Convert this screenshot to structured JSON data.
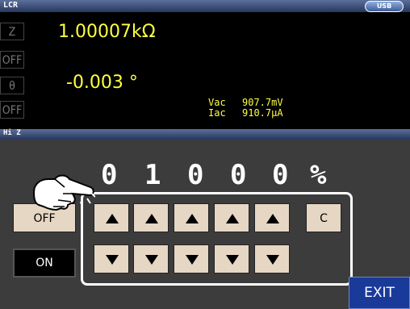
{
  "header": {
    "title": "LCR",
    "usb_label": "USB"
  },
  "params": {
    "p1_label": "Z",
    "p1_value": "1.00007kΩ",
    "p2_label": "OFF",
    "p3_label": "θ",
    "p3_value": "-0.003 °",
    "p4_label": "OFF"
  },
  "monitor": {
    "vac_label": "Vac",
    "vac_value": "907.7mV",
    "iac_label": "Iac",
    "iac_value": "910.7µA"
  },
  "sub": {
    "title": "Hi Z"
  },
  "setting": {
    "digits": [
      "0",
      "1",
      "0",
      "0",
      "0"
    ],
    "unit": "%"
  },
  "buttons": {
    "off": "OFF",
    "on": "ON",
    "clear": "C",
    "exit": "EXIT"
  },
  "icons": {
    "up": "triangle-up-icon",
    "down": "triangle-down-icon",
    "pointer": "pointing-hand-icon"
  }
}
